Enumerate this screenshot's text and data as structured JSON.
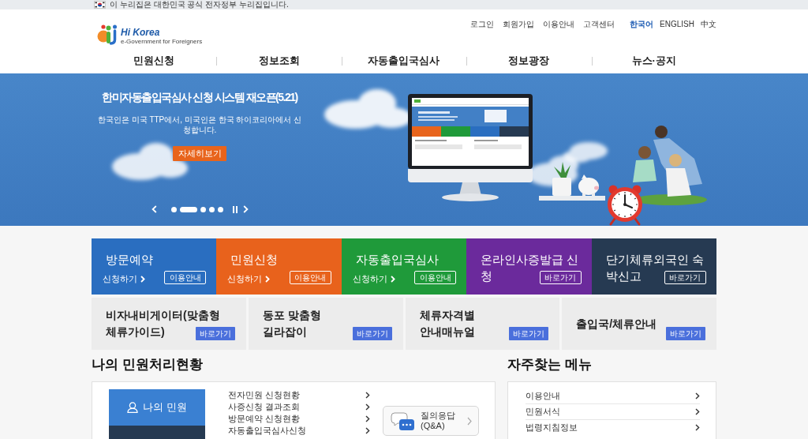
{
  "gov_notice": {
    "text": "이 누리집은 대한민국 공식 전자정부 누리집입니다."
  },
  "header": {
    "logo": {
      "name": "Hi Korea",
      "tagline": "e-Government for Foreigners"
    },
    "utility_links": [
      "로그인",
      "회원가입",
      "이용안내",
      "고객센터"
    ],
    "languages": [
      {
        "label": "한국어",
        "selected": true
      },
      {
        "label": "ENGLISH",
        "selected": false
      },
      {
        "label": "中文",
        "selected": false
      }
    ]
  },
  "nav": {
    "items": [
      "민원신청",
      "정보조회",
      "자동출입국심사",
      "정보광장",
      "뉴스·공지"
    ]
  },
  "hero": {
    "title": "한미자동출입국심사 신청 시스템 재오픈(5.21)",
    "text": "한국인은 미국 TTP에서, 미국인은 한국 하이코리아에서 신청합니다.",
    "button": "자세히보기",
    "slides": [
      {
        "selected": false
      },
      {
        "selected": true
      },
      {
        "selected": false
      },
      {
        "selected": false
      },
      {
        "selected": false
      }
    ]
  },
  "service_tiles": [
    {
      "title_lines": [
        "방문예약"
      ],
      "link": "신청하기",
      "button": "이용안내",
      "color": "#2a6ec0"
    },
    {
      "title_lines": [
        "민원신청"
      ],
      "link": "신청하기",
      "button": "이용안내",
      "color": "#e8621c"
    },
    {
      "title_lines": [
        "자동출입국심사"
      ],
      "link": "신청하기",
      "button": "이용안내",
      "color": "#1f9a3a"
    },
    {
      "title_lines": [
        "온라인사증발급 신",
        "청"
      ],
      "button": "바로가기",
      "color": "#6b2a9c"
    },
    {
      "title_lines": [
        "단기체류외국인 숙",
        "박신고"
      ],
      "button": "바로가기",
      "color": "#263a52"
    }
  ],
  "quick_tiles": [
    {
      "title_lines": [
        "비자내비게이터(맞춤형",
        "체류가이드)"
      ],
      "button": "바로가기"
    },
    {
      "title_lines": [
        "동포 맞춤형",
        "길라잡이"
      ],
      "button": "바로가기"
    },
    {
      "title_lines": [
        "체류자격별",
        "안내매뉴얼"
      ],
      "button": "바로가기"
    },
    {
      "title_lines": [
        "출입국/체류안내"
      ],
      "button": "바로가기"
    }
  ],
  "my_status": {
    "heading": "나의 민원처리현황",
    "panel": "나의 민원",
    "links": [
      "전자민원 신청현황",
      "사증신청 결과조회",
      "방문예약 신청현황",
      "자동출입국심사신청"
    ],
    "qna": "질의응답 (Q&A)"
  },
  "frequent_menu": {
    "heading": "자주찾는 메뉴",
    "items": [
      "이용안내",
      "민원서식",
      "법령지침정보"
    ]
  }
}
